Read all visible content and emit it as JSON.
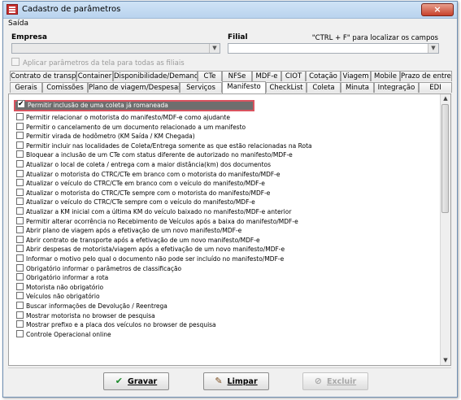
{
  "window": {
    "title": "Cadastro de parâmetros",
    "close_glyph": "×"
  },
  "menubar": {
    "saida": "Saída"
  },
  "empresa": {
    "label": "Empresa",
    "value": ""
  },
  "filial": {
    "label": "Filial",
    "value": "",
    "hint": "\"CTRL + F\" para localizar os campos"
  },
  "aplicar_label": "Aplicar parâmetros da tela para todas as filiais",
  "tabs_row1": [
    "Contrato de transporte",
    "Container",
    "Disponibilidade/Demanda",
    "CTe",
    "NFSe",
    "MDF-e",
    "CIOT",
    "Cotação",
    "Viagem",
    "Mobile",
    "Prazo de entrega"
  ],
  "tabs_row2": [
    "Gerais",
    "Comissões",
    "Plano de viagem/Despesas",
    "Serviços",
    "Manifesto",
    "CheckList",
    "Coleta",
    "Minuta",
    "Integração",
    "EDI"
  ],
  "active_tab": "Manifesto",
  "options": [
    {
      "label": "Permitir inclusão de uma coleta já romaneada",
      "checked": true
    },
    {
      "label": "Permitir relacionar o motorista do manifesto/MDF-e como ajudante",
      "checked": false
    },
    {
      "label": "Permitir o cancelamento de um documento relacionado a um manifesto",
      "checked": false
    },
    {
      "label": "Permitir virada de hodômetro (KM Saída / KM Chegada)",
      "checked": false
    },
    {
      "label": "Permitir incluir nas localidades de Coleta/Entrega somente as que estão relacionadas na Rota",
      "checked": false
    },
    {
      "label": "Bloquear a inclusão de um CTe com status diferente de autorizado no manifesto/MDF-e",
      "checked": false
    },
    {
      "label": "Atualizar o local de coleta / entrega com a maior distância(km) dos documentos",
      "checked": false
    },
    {
      "label": "Atualizar o motorista do CTRC/CTe em branco com o motorista do manifesto/MDF-e",
      "checked": false
    },
    {
      "label": "Atualizar o veículo do CTRC/CTe em branco com o veículo do manifesto/MDF-e",
      "checked": false
    },
    {
      "label": "Atualizar o motorista do CTRC/CTe sempre com o motorista do manifesto/MDF-e",
      "checked": false
    },
    {
      "label": "Atualizar o veículo do CTRC/CTe sempre com o veículo do manifesto/MDF-e",
      "checked": false
    },
    {
      "label": "Atualizar a KM inicial com a última KM do veículo baixado no manifesto/MDF-e anterior",
      "checked": false
    },
    {
      "label": "Permitir alterar ocorrência no Recebimento de Veículos após a baixa do manifesto/MDF-e",
      "checked": false
    },
    {
      "label": "Abrir plano de viagem após a efetivação de um novo manifesto/MDF-e",
      "checked": false
    },
    {
      "label": "Abrir contrato de transporte após a efetivação de um novo manifesto/MDF-e",
      "checked": false
    },
    {
      "label": "Abrir despesas de motorista/viagem após a efetivação de um novo manifesto/MDF-e",
      "checked": false
    },
    {
      "label": "Informar o motivo pelo qual o documento não pode ser incluído no manifesto/MDF-e",
      "checked": false
    },
    {
      "label": "Obrigatório informar o parâmetros de classificação",
      "checked": false
    },
    {
      "label": "Obrigatório informar a rota",
      "checked": false
    },
    {
      "label": "Motorista não obrigatório",
      "checked": false
    },
    {
      "label": "Veículos não obrigatório",
      "checked": false
    },
    {
      "label": "Buscar informações de Devolução / Reentrega",
      "checked": false
    },
    {
      "label": "Mostrar motorista no browser de pesquisa",
      "checked": false
    },
    {
      "label": "Mostrar prefixo e a placa dos veículos no browser de pesquisa",
      "checked": false
    },
    {
      "label": "Controle Operacional online",
      "checked": false
    }
  ],
  "buttons": {
    "gravar": {
      "label": "Gravar",
      "icon": "check-icon",
      "enabled": true
    },
    "limpar": {
      "label": "Limpar",
      "icon": "broom-icon",
      "enabled": true
    },
    "excluir": {
      "label": "Excluir",
      "icon": "delete-icon",
      "enabled": false
    }
  }
}
